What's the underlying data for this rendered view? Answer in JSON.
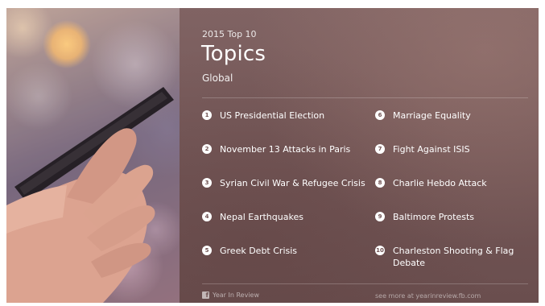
{
  "header": {
    "year_label": "2015 Top 10",
    "title": "Topics",
    "subtitle": "Global"
  },
  "topics_left": [
    {
      "number": "1",
      "label": "US Presidential Election"
    },
    {
      "number": "2",
      "label": "November 13 Attacks in Paris"
    },
    {
      "number": "3",
      "label": "Syrian Civil War & Refugee Crisis"
    },
    {
      "number": "4",
      "label": "Nepal Earthquakes"
    },
    {
      "number": "5",
      "label": "Greek Debt Crisis"
    }
  ],
  "topics_right": [
    {
      "number": "6",
      "label": "Marriage Equality"
    },
    {
      "number": "7",
      "label": "Fight Against ISIS"
    },
    {
      "number": "8",
      "label": "Charlie Hebdo Attack"
    },
    {
      "number": "9",
      "label": "Baltimore Protests"
    },
    {
      "number": "10",
      "label": "Charleston Shooting & Flag Debate"
    }
  ],
  "footer": {
    "brand_icon": "facebook-icon",
    "brand_label": "Year In Review",
    "link_text": "see more at yearinreview.fb.com"
  },
  "colors": {
    "panel_background": "#735656",
    "text": "#ffffff",
    "number_badge_text": "#6f5252"
  }
}
